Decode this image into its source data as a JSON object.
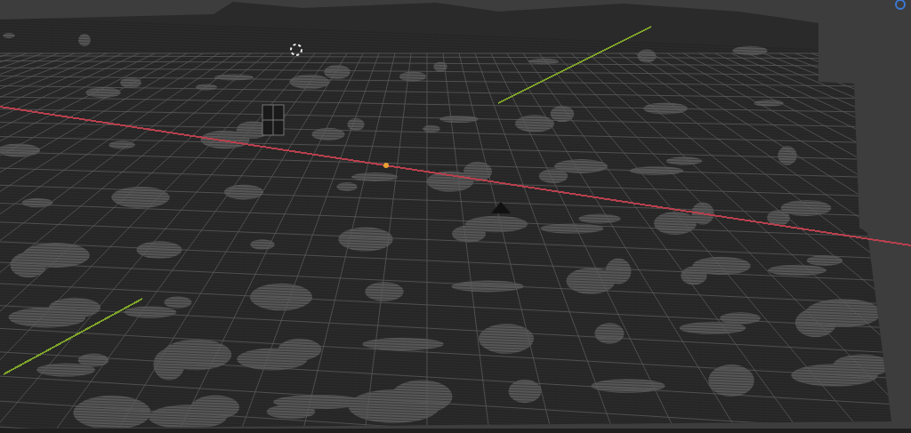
{
  "viewport": {
    "axes": [
      {
        "kind": "x",
        "color": "#b8404e"
      },
      {
        "kind": "y",
        "color": "#7ea42a"
      }
    ]
  }
}
